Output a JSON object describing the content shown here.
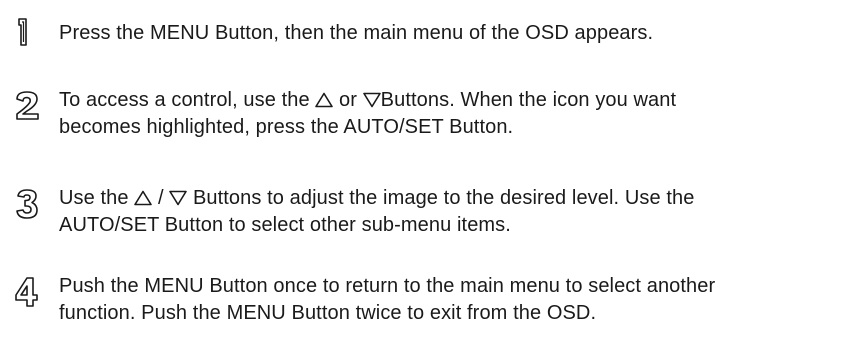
{
  "steps": [
    {
      "number": "1",
      "line1": "Press the MENU Button, then the main menu of the OSD appears."
    },
    {
      "number": "2",
      "line1_a": "To access a control, use the ",
      "line1_b": " or ",
      "line1_c": "Buttons. When the icon you want",
      "line2": "becomes highlighted, press the AUTO/SET Button.",
      "icons": [
        "up-triangle-icon",
        "down-triangle-icon"
      ]
    },
    {
      "number": "3",
      "line1_a": " Use the ",
      "line1_b": " / ",
      "line1_c": " Buttons to adjust the image to the desired level. Use the",
      "line2": "AUTO/SET Button to select other sub-menu items.",
      "icons": [
        "up-triangle-icon",
        "down-triangle-icon"
      ]
    },
    {
      "number": "4",
      "line1": "Push the MENU Button once to return to the main menu to select another",
      "line2": "function. Push the MENU Button twice to exit from the OSD."
    }
  ]
}
